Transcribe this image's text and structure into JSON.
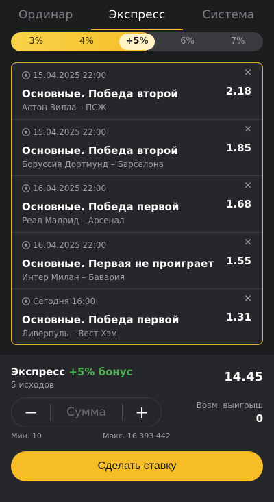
{
  "tabs": [
    {
      "label": "Ординар",
      "active": false
    },
    {
      "label": "Экспресс",
      "active": true
    },
    {
      "label": "Система",
      "active": false
    }
  ],
  "bonus_scale": {
    "options": [
      "3%",
      "4%",
      "+5%",
      "6%",
      "7%"
    ],
    "selected_index": 2,
    "fill_fraction": 0.56
  },
  "bets": [
    {
      "date": "15.04.2025 22:00",
      "title": "Основные. Победа второй",
      "teams": "Астон Вилла – ПСЖ",
      "odds": "2.18"
    },
    {
      "date": "15.04.2025 22:00",
      "title": "Основные. Победа второй",
      "teams": "Боруссия Дортмунд – Барселона",
      "odds": "1.85"
    },
    {
      "date": "16.04.2025 22:00",
      "title": "Основные. Победа первой",
      "teams": "Реал Мадрид – Арсенал",
      "odds": "1.68"
    },
    {
      "date": "16.04.2025 22:00",
      "title": "Основные. Первая не проиграет",
      "teams": "Интер Милан – Бавария",
      "odds": "1.55"
    },
    {
      "date": "Сегодня 16:00",
      "title": "Основные. Победа первой",
      "teams": "Ливерпуль – Вест Хэм",
      "odds": "1.31"
    }
  ],
  "summary": {
    "title": "Экспресс",
    "bonus": "+5% бонус",
    "outcomes": "5 исходов",
    "total_odds": "14.45"
  },
  "stake": {
    "minus": "−",
    "plus": "+",
    "placeholder": "Сумма",
    "min": "Мин. 10",
    "max": "Макс. 16 393 442"
  },
  "win": {
    "label": "Возм. выигрыш",
    "value": "0"
  },
  "place_bet_label": "Сделать ставку",
  "close_glyph": "×",
  "colors": {
    "accent": "#f6bd27",
    "bonus_green": "#4caf50",
    "background": "#1c1d1f",
    "card": "#26272a"
  },
  "icons": {
    "sport": "soccer-ball-icon",
    "remove": "close-icon"
  }
}
